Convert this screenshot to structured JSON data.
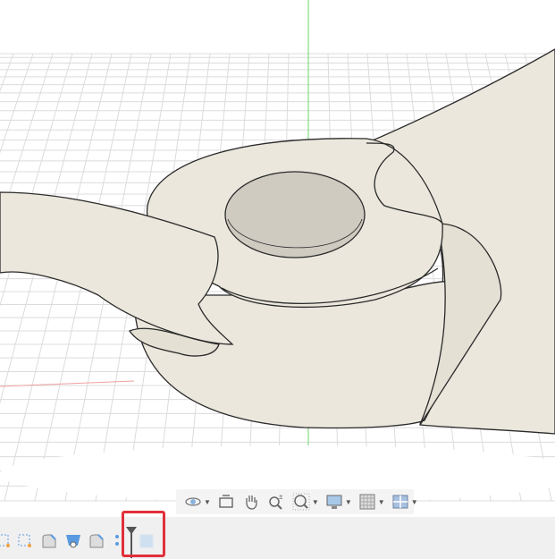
{
  "viewport": {
    "model": "propeller-hub-body",
    "colors": {
      "body": "#ebe7dc",
      "edge": "#2a2a2a",
      "grid": "#d9d9d9",
      "y_axis": "#5ad65a",
      "x_axis": "#e86060",
      "highlight": "#e0303a"
    }
  },
  "nav_toolbar": {
    "items": [
      {
        "icon": "orbit-icon",
        "has_menu": true
      },
      {
        "icon": "look-at-icon",
        "has_menu": false
      },
      {
        "icon": "pan-icon",
        "has_menu": false
      },
      {
        "icon": "zoom-icon",
        "has_menu": false
      },
      {
        "icon": "fit-icon",
        "has_menu": true
      },
      {
        "icon": "display-settings-icon",
        "has_menu": true
      },
      {
        "icon": "grid-settings-icon",
        "has_menu": true
      },
      {
        "icon": "viewports-icon",
        "has_menu": true
      }
    ]
  },
  "timeline": {
    "items": [
      "sketch-icon",
      "sketch-icon",
      "fillet-icon",
      "shell-icon",
      "fillet-icon"
    ],
    "marker": "timeline-marker-icon",
    "highlighted_item": "body-feature-icon"
  }
}
